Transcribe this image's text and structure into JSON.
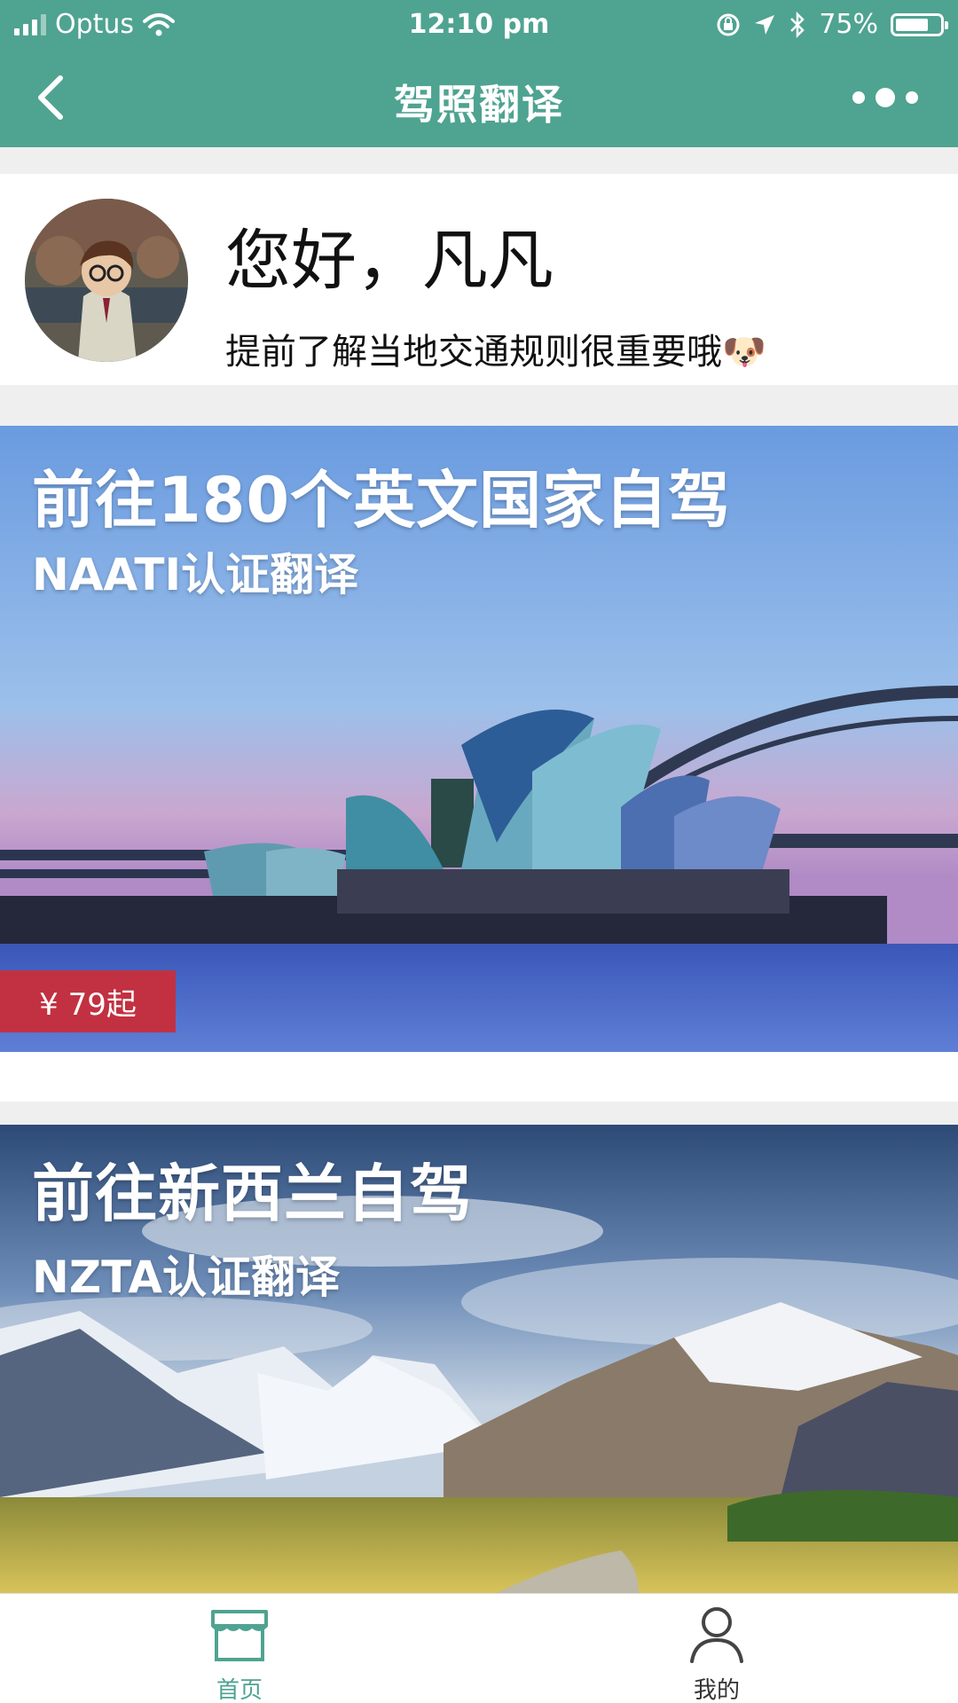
{
  "status_bar": {
    "carrier": "Optus",
    "time": "12:10 pm",
    "battery_percent": "75%",
    "battery_level": 0.75
  },
  "nav": {
    "title": "驾照翻译",
    "back_icon": "chevron-left-icon",
    "more_icon": "more-dots-icon"
  },
  "profile": {
    "greeting": "您好，凡凡",
    "tip": "提前了解当地交通规则很重要哦🐶"
  },
  "banners": [
    {
      "title": "前往180个英文国家自驾",
      "subtitle": "NAATI认证翻译",
      "price": "¥ 79起"
    },
    {
      "title": "前往新西兰自驾",
      "subtitle": "NZTA认证翻译"
    }
  ],
  "tabbar": {
    "items": [
      {
        "label": "首页",
        "icon": "store-icon",
        "active": true
      },
      {
        "label": "我的",
        "icon": "user-icon",
        "active": false
      }
    ]
  },
  "colors": {
    "brand": "#4fa391",
    "price_tag": "#c23141"
  }
}
